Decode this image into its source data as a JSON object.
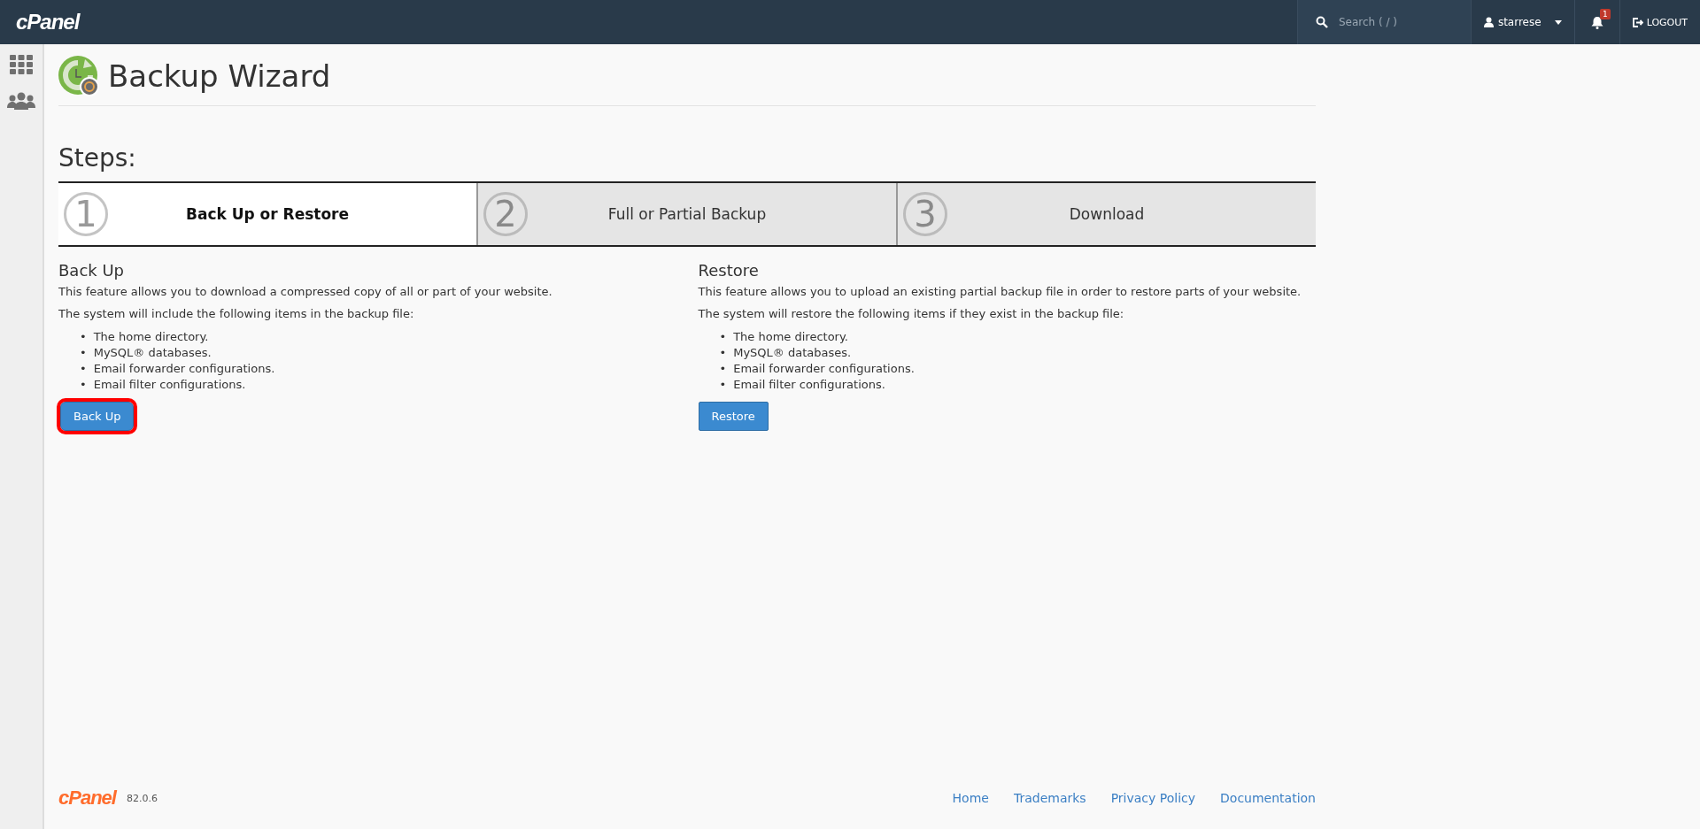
{
  "top_bar": {
    "logo": "cPanel",
    "search": {
      "placeholder": "Search ( / )"
    },
    "user": "starrese",
    "notifications": "1",
    "logout": "LOGOUT"
  },
  "page": {
    "title": "Backup Wizard",
    "steps_heading": "Steps:"
  },
  "steps": [
    {
      "number": "1",
      "label": "Back Up or Restore",
      "selected": true
    },
    {
      "number": "2",
      "label": "Full or Partial Backup",
      "selected": false
    },
    {
      "number": "3",
      "label": "Download",
      "selected": false
    }
  ],
  "sections": [
    {
      "heading": "Back Up",
      "description": "This feature allows you to download a compressed copy of all or part of your website.",
      "intro": "The system will include the following items in the backup file:",
      "bullet": "•",
      "items": [
        "The home directory.",
        "MySQL® databases.",
        "Email forwarder configurations.",
        "Email filter configurations."
      ],
      "button": {
        "label": "Back Up",
        "highlighted": true
      }
    },
    {
      "heading": "Restore",
      "description": "This feature allows you to upload an existing partial backup file in order to restore parts of your website.",
      "intro": "The system will restore the following items if they exist in the backup file:",
      "bullet": "•",
      "items": [
        "The home directory.",
        "MySQL® databases.",
        "Email forwarder configurations.",
        "Email filter configurations."
      ],
      "button": {
        "label": "Restore",
        "highlighted": false
      }
    }
  ],
  "footer": {
    "logo": "cPanel",
    "version": "82.0.6",
    "links": [
      "Home",
      "Trademarks",
      "Privacy Policy",
      "Documentation"
    ]
  }
}
